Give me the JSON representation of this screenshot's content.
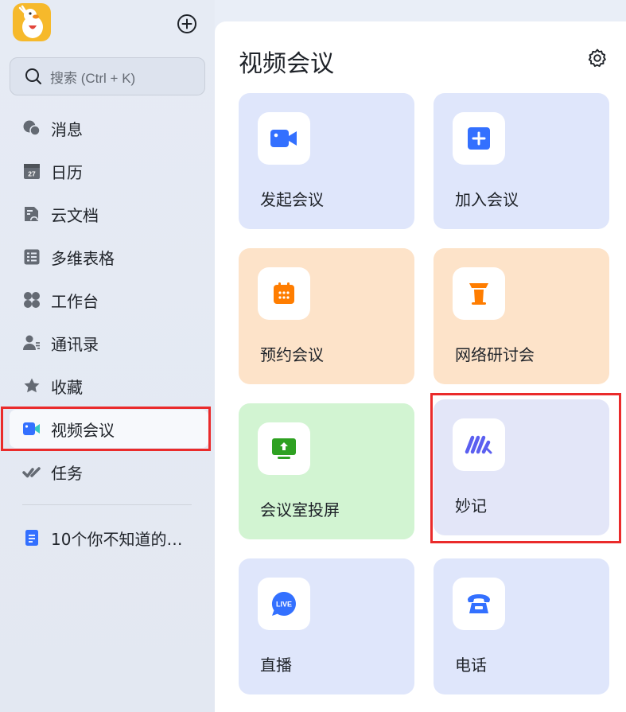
{
  "sidebar": {
    "search_placeholder": "搜索 (Ctrl + K)",
    "items": [
      {
        "label": "消息",
        "icon": "chat-bubbles-icon"
      },
      {
        "label": "日历",
        "icon": "calendar-icon"
      },
      {
        "label": "云文档",
        "icon": "cloud-doc-icon"
      },
      {
        "label": "多维表格",
        "icon": "base-table-icon"
      },
      {
        "label": "工作台",
        "icon": "workplace-icon"
      },
      {
        "label": "通讯录",
        "icon": "contacts-icon"
      },
      {
        "label": "收藏",
        "icon": "star-icon"
      },
      {
        "label": "视频会议",
        "icon": "video-camera-icon",
        "active": true
      },
      {
        "label": "任务",
        "icon": "task-check-icon"
      }
    ],
    "calendar_icon_text": "27",
    "recent": [
      {
        "label": "10个你不知道的…",
        "icon": "document-icon"
      }
    ]
  },
  "main": {
    "title": "视频会议",
    "tiles": [
      {
        "label": "发起会议",
        "icon": "video-camera-icon",
        "color": "#dfe6fb"
      },
      {
        "label": "加入会议",
        "icon": "plus-square-icon",
        "color": "#dfe6fb"
      },
      {
        "label": "预约会议",
        "icon": "calendar-schedule-icon",
        "color": "#fde3c9"
      },
      {
        "label": "网络研讨会",
        "icon": "podium-icon",
        "color": "#fde3c9"
      },
      {
        "label": "会议室投屏",
        "icon": "screen-share-icon",
        "color": "#d2f4d2"
      },
      {
        "label": "妙记",
        "icon": "minutes-icon",
        "color": "#e3e6f8"
      },
      {
        "label": "直播",
        "icon": "live-icon",
        "color": "#dfe6fb",
        "badge": "LIVE"
      },
      {
        "label": "电话",
        "icon": "telephone-icon",
        "color": "#dfe6fb"
      }
    ]
  },
  "colors": {
    "accent_blue": "#3370ff",
    "accent_orange": "#ff7d00",
    "accent_green": "#2ea121",
    "accent_purple": "#5b5ff0",
    "highlight_red": "#ea2b2b"
  }
}
